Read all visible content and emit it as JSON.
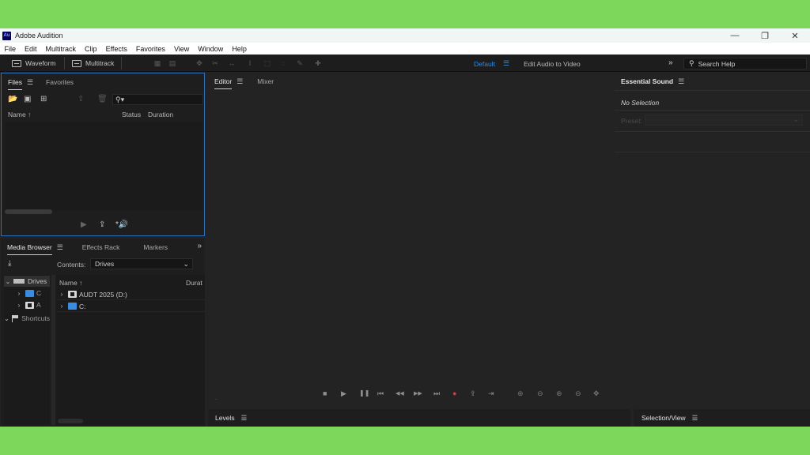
{
  "titlebar": {
    "app_icon_text": "Au",
    "title": "Adobe Audition",
    "minimize_glyph": "—",
    "maximize_glyph": "❐",
    "close_glyph": "✕"
  },
  "menu": [
    "File",
    "Edit",
    "Multitrack",
    "Clip",
    "Effects",
    "Favorites",
    "View",
    "Window",
    "Help"
  ],
  "toolbar": {
    "waveform_label": "Waveform",
    "multitrack_label": "Multitrack",
    "workspace_default": "Default",
    "workspace_menu_glyph": "☰",
    "workspace_edit_audio": "Edit Audio to Video",
    "more_glyph": "»",
    "search_placeholder": "Search Help",
    "search_glyph": "⚲"
  },
  "files_panel": {
    "tab_files": "Files",
    "tab_favorites": "Favorites",
    "menu_glyph": "☰",
    "search_glyph": "⚲▾",
    "col_name": "Name ↑",
    "col_status": "Status",
    "col_duration": "Duration",
    "footer_play": "▶",
    "footer_loop": "⇪",
    "footer_autoplay": "*🔊"
  },
  "media_browser": {
    "tab_media": "Media Browser",
    "menu_glyph": "☰",
    "tab_effects": "Effects Rack",
    "tab_markers": "Markers",
    "more_glyph": "»",
    "contents_label": "Contents:",
    "contents_value": "Drives",
    "contents_chevron": "⌄",
    "left_tree": {
      "drives": "Drives",
      "row_c": "C",
      "row_a": "A",
      "shortcuts": "Shortcuts"
    },
    "right_header_name": "Name ↑",
    "right_header_dur": "Durat",
    "rows": [
      "AUDT 2025 (D:)",
      "C:"
    ]
  },
  "editor_panel": {
    "tab_editor": "Editor",
    "menu_glyph": "☰",
    "tab_mixer": "Mixer",
    "dot": ".",
    "transport": {
      "stop": "■",
      "play": "▶",
      "pause": "❚❚",
      "go_start": "⏮",
      "rewind": "◀◀",
      "forward": "▶▶",
      "go_end": "⏭",
      "record": "●",
      "export": "⇪",
      "skip": "⇥"
    },
    "zoom": {
      "zoom_in_amp": "⊕",
      "zoom_out_amp": "⊖",
      "zoom_in_time": "⊕",
      "zoom_out_time": "⊖",
      "zoom_full": "✥"
    }
  },
  "essential_sound": {
    "title": "Essential Sound",
    "menu_glyph": "☰",
    "no_selection": "No Selection",
    "preset_label": "Preset:",
    "preset_chevron": "⌄"
  },
  "bottom_panels": {
    "levels": "Levels",
    "levels_menu": "☰",
    "selection_view": "Selection/View",
    "selection_menu": "☰"
  },
  "colors": {
    "workspace_active": "#2d8ceb",
    "record_red": "#e33333",
    "panel_focus_border": "#2e6fb5",
    "background_green": "#7dd75a"
  }
}
